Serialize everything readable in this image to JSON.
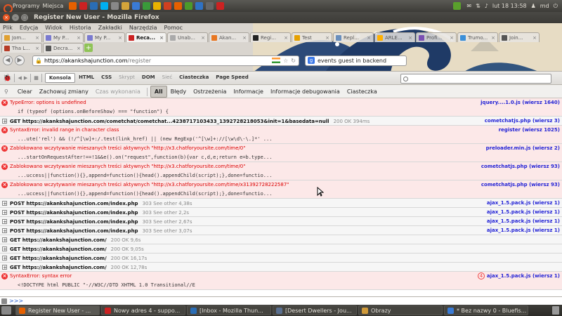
{
  "top_panel": {
    "menu": "Programy",
    "places": "Miejsca",
    "clock": "lut 18 13:58",
    "user": "md"
  },
  "window": {
    "title": "Register New User - Mozilla Firefox"
  },
  "menubar": [
    "Plik",
    "Edycja",
    "Widok",
    "Historia",
    "Zakładki",
    "Narzędzia",
    "Pomoc"
  ],
  "tabs_row1": [
    {
      "label": "Jom...",
      "color": "#e0a030"
    },
    {
      "label": "My P...",
      "color": "#7a7ad0"
    },
    {
      "label": "My P...",
      "color": "#7a7ad0"
    },
    {
      "label": "Reca...",
      "color": "#cc2222",
      "active": true
    },
    {
      "label": "Unab...",
      "color": "#aaaaaa"
    },
    {
      "label": "Akan...",
      "color": "#e87722"
    },
    {
      "label": "Regi...",
      "color": "#222222"
    },
    {
      "label": "Test",
      "color": "#e6a100"
    },
    {
      "label": "Repl...",
      "color": "#6a8fbd"
    },
    {
      "label": "ARLE...",
      "color": "#ffb000"
    },
    {
      "label": "Profi...",
      "color": "#7a4fb3"
    },
    {
      "label": "Trumo...",
      "color": "#3a8fd8"
    },
    {
      "label": "Join...",
      "color": "#555555"
    }
  ],
  "tabs_row2": [
    {
      "label": "Tha L...",
      "color": "#b63b26"
    },
    {
      "label": "Decra...",
      "color": "#555555"
    }
  ],
  "url": {
    "host": "https://akankshajunction.com",
    "path": "/register"
  },
  "search": {
    "value": "events guest in backend"
  },
  "firebug": {
    "tabs": [
      {
        "label": "Konsola",
        "dim": false
      },
      {
        "label": "HTML",
        "dim": false
      },
      {
        "label": "CSS",
        "dim": false
      },
      {
        "label": "Skrypt",
        "dim": true
      },
      {
        "label": "DOM",
        "dim": false
      },
      {
        "label": "Sieć",
        "dim": true
      },
      {
        "label": "Ciasteczka",
        "dim": false
      },
      {
        "label": "Page Speed",
        "dim": false
      }
    ]
  },
  "filter": {
    "clear": "Clear",
    "persist": "Zachowuj zmiany",
    "profile": "Czas wykonania",
    "all": "All",
    "errors": "Błędy",
    "warnings": "Ostrzeżenia",
    "info": "Informacje",
    "debug": "Informacje debugowania",
    "cookies": "Ciasteczka"
  },
  "log": [
    {
      "kind": "error",
      "msg": "TypeError: options is undefined",
      "src": "jquery....1.0.js (wiersz 1640)",
      "code": "if (typeof (options.onBeforeShow) === \"function\") {"
    },
    {
      "kind": "net",
      "msg": "GET https://akankshajunction.com/cometchat/cometchat...4238717103433_1392728218053&init=1&basedata=null",
      "status": "200 OK 394ms",
      "src": "cometchatjs.php (wiersz 3)"
    },
    {
      "kind": "error",
      "msg": "SyntaxError: invalid range in character class",
      "src": "register (wiersz 1025)",
      "code": "...ute('rel') && (!/^[\\w]+:/.test(link_href) || (new RegExp('^[\\w]+://[\\w\\d\\-\\.]*' ..."
    },
    {
      "kind": "error",
      "msg": "Zablokowano wczytywanie mieszanych treści aktywnych \"http://x3.chatforyoursite.com/time/0\"",
      "src": "preloader.min.js (wiersz 2)",
      "code": "...startOnRequestAfter!==!1&&e().on(\"request\",function(b){var c,d,e;return e=b.type..."
    },
    {
      "kind": "error",
      "msg": "Zablokowano wczytywanie mieszanych treści aktywnych \"http://x3.chatforyoursite.com/time/0\"",
      "src": "cometchatjs.php (wiersz 93)",
      "code": "...uccess||function(){},append=function(){head().appendChild(script);},done=functio..."
    },
    {
      "kind": "error",
      "msg": "Zablokowano wczytywanie mieszanych treści aktywnych \"http://x3.chatforyoursite.com/time/x31392728222587\"",
      "src": "cometchatjs.php (wiersz 93)",
      "code": "...uccess||function(){},append=function(){head().appendChild(script);},done=functio..."
    },
    {
      "kind": "net",
      "msg": "POST https://akankshajunction.com/index.php",
      "status": "303 See other 4,38s",
      "src": "ajax_1.5.pack.js (wiersz 1)"
    },
    {
      "kind": "net",
      "msg": "POST https://akankshajunction.com/index.php",
      "status": "303 See other 2,2s",
      "src": "ajax_1.5.pack.js (wiersz 1)"
    },
    {
      "kind": "net",
      "msg": "POST https://akankshajunction.com/index.php",
      "status": "303 See other 2,67s",
      "src": "ajax_1.5.pack.js (wiersz 1)"
    },
    {
      "kind": "net",
      "msg": "POST https://akankshajunction.com/index.php",
      "status": "303 See other 3,07s",
      "src": "ajax_1.5.pack.js (wiersz 1)"
    },
    {
      "kind": "net",
      "msg": "GET https://akankshajunction.com/",
      "status": "200 OK 9,6s",
      "src": ""
    },
    {
      "kind": "net",
      "msg": "GET https://akankshajunction.com/",
      "status": "200 OK 9,05s",
      "src": ""
    },
    {
      "kind": "net",
      "msg": "GET https://akankshajunction.com/",
      "status": "200 OK 16,17s",
      "src": ""
    },
    {
      "kind": "net",
      "msg": "GET https://akankshajunction.com/",
      "status": "200 OK 12,78s",
      "src": ""
    },
    {
      "kind": "error",
      "msg": "SyntaxError: syntax error",
      "src": "ajax_1.5.pack.js (wiersz 1)",
      "count": "4",
      "code": "<!DOCTYPE html PUBLIC \"-//W3C//DTD XHTML 1.0 Transitional//E"
    }
  ],
  "cmdline": {
    "prompt": ">>>"
  },
  "taskbar": [
    {
      "label": "Register New User - ...",
      "color": "#e66000",
      "active": true
    },
    {
      "label": "Nowy adres 4 - suppo...",
      "color": "#cc2222"
    },
    {
      "label": "[Inbox - Mozilla Thun...",
      "color": "#2a6db5"
    },
    {
      "label": "[Desert Dwellers - Jou...",
      "color": "#5a6f8f"
    },
    {
      "label": "Obrazy",
      "color": "#d09a3a"
    },
    {
      "label": "* Bez nazwy 0 - Bluefis...",
      "color": "#3a7bd5"
    }
  ]
}
